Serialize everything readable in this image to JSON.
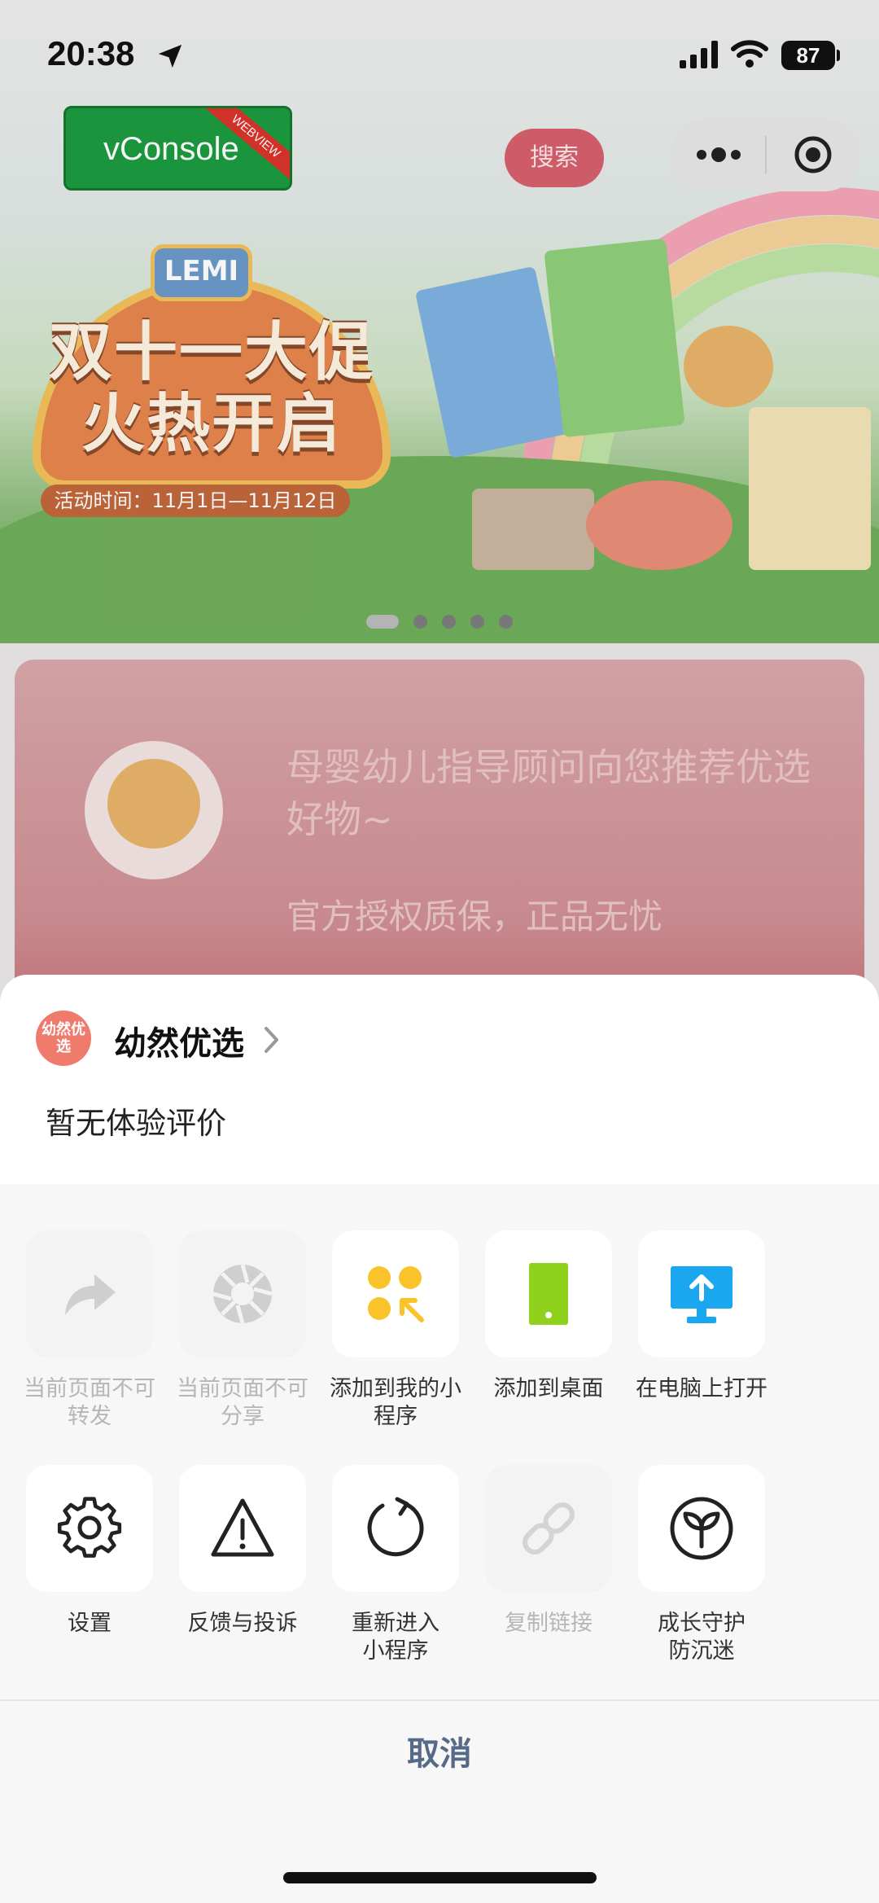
{
  "status_bar": {
    "time": "20:38",
    "battery": "87"
  },
  "overlay": {
    "vconsole_label": "vConsole",
    "vconsole_ribbon": "WEBVIEW"
  },
  "page_header": {
    "search_label": "搜索"
  },
  "banner": {
    "badge": "LEMI",
    "title_line1": "双十一大促",
    "title_line2": "火热开启",
    "date_text": "活动时间：11月1日—11月12日",
    "carousel_count": 5,
    "carousel_active": 1
  },
  "advisor": {
    "line1": "母婴幼儿指导顾问向您推荐优选好物~",
    "line2": "官方授权质保，正品无忧"
  },
  "sheet": {
    "app_logo_text": "幼然优选",
    "app_name": "幼然优选",
    "rating_text": "暂无体验评价",
    "row1": [
      {
        "label": "当前页面不可转发",
        "icon": "share-forward-icon",
        "disabled": true
      },
      {
        "label": "当前页面不可分享",
        "icon": "shutter-icon",
        "disabled": true
      },
      {
        "label": "添加到我的小程序",
        "icon": "add-mini-program-icon",
        "disabled": false
      },
      {
        "label": "添加到桌面",
        "icon": "phone-desktop-icon",
        "disabled": false
      },
      {
        "label": "在电脑上打开",
        "icon": "monitor-upload-icon",
        "disabled": false
      }
    ],
    "row2": [
      {
        "label": "设置",
        "icon": "gear-icon",
        "disabled": false
      },
      {
        "label": "反馈与投诉",
        "icon": "warning-icon",
        "disabled": false
      },
      {
        "label": "重新进入小程序",
        "icon": "reload-icon",
        "disabled": false
      },
      {
        "label": "复制链接",
        "icon": "link-icon",
        "disabled": true
      },
      {
        "label": "成长守护防沉迷",
        "icon": "sprout-icon",
        "disabled": false
      }
    ],
    "cancel_label": "取消"
  },
  "colors": {
    "sheet_bg": "#f7f7f7",
    "accent_yellow": "#fbc32a",
    "accent_green": "#8fd11c",
    "accent_blue": "#1aa7f0",
    "cancel_text": "#566987",
    "search_button": "#d6606d"
  }
}
